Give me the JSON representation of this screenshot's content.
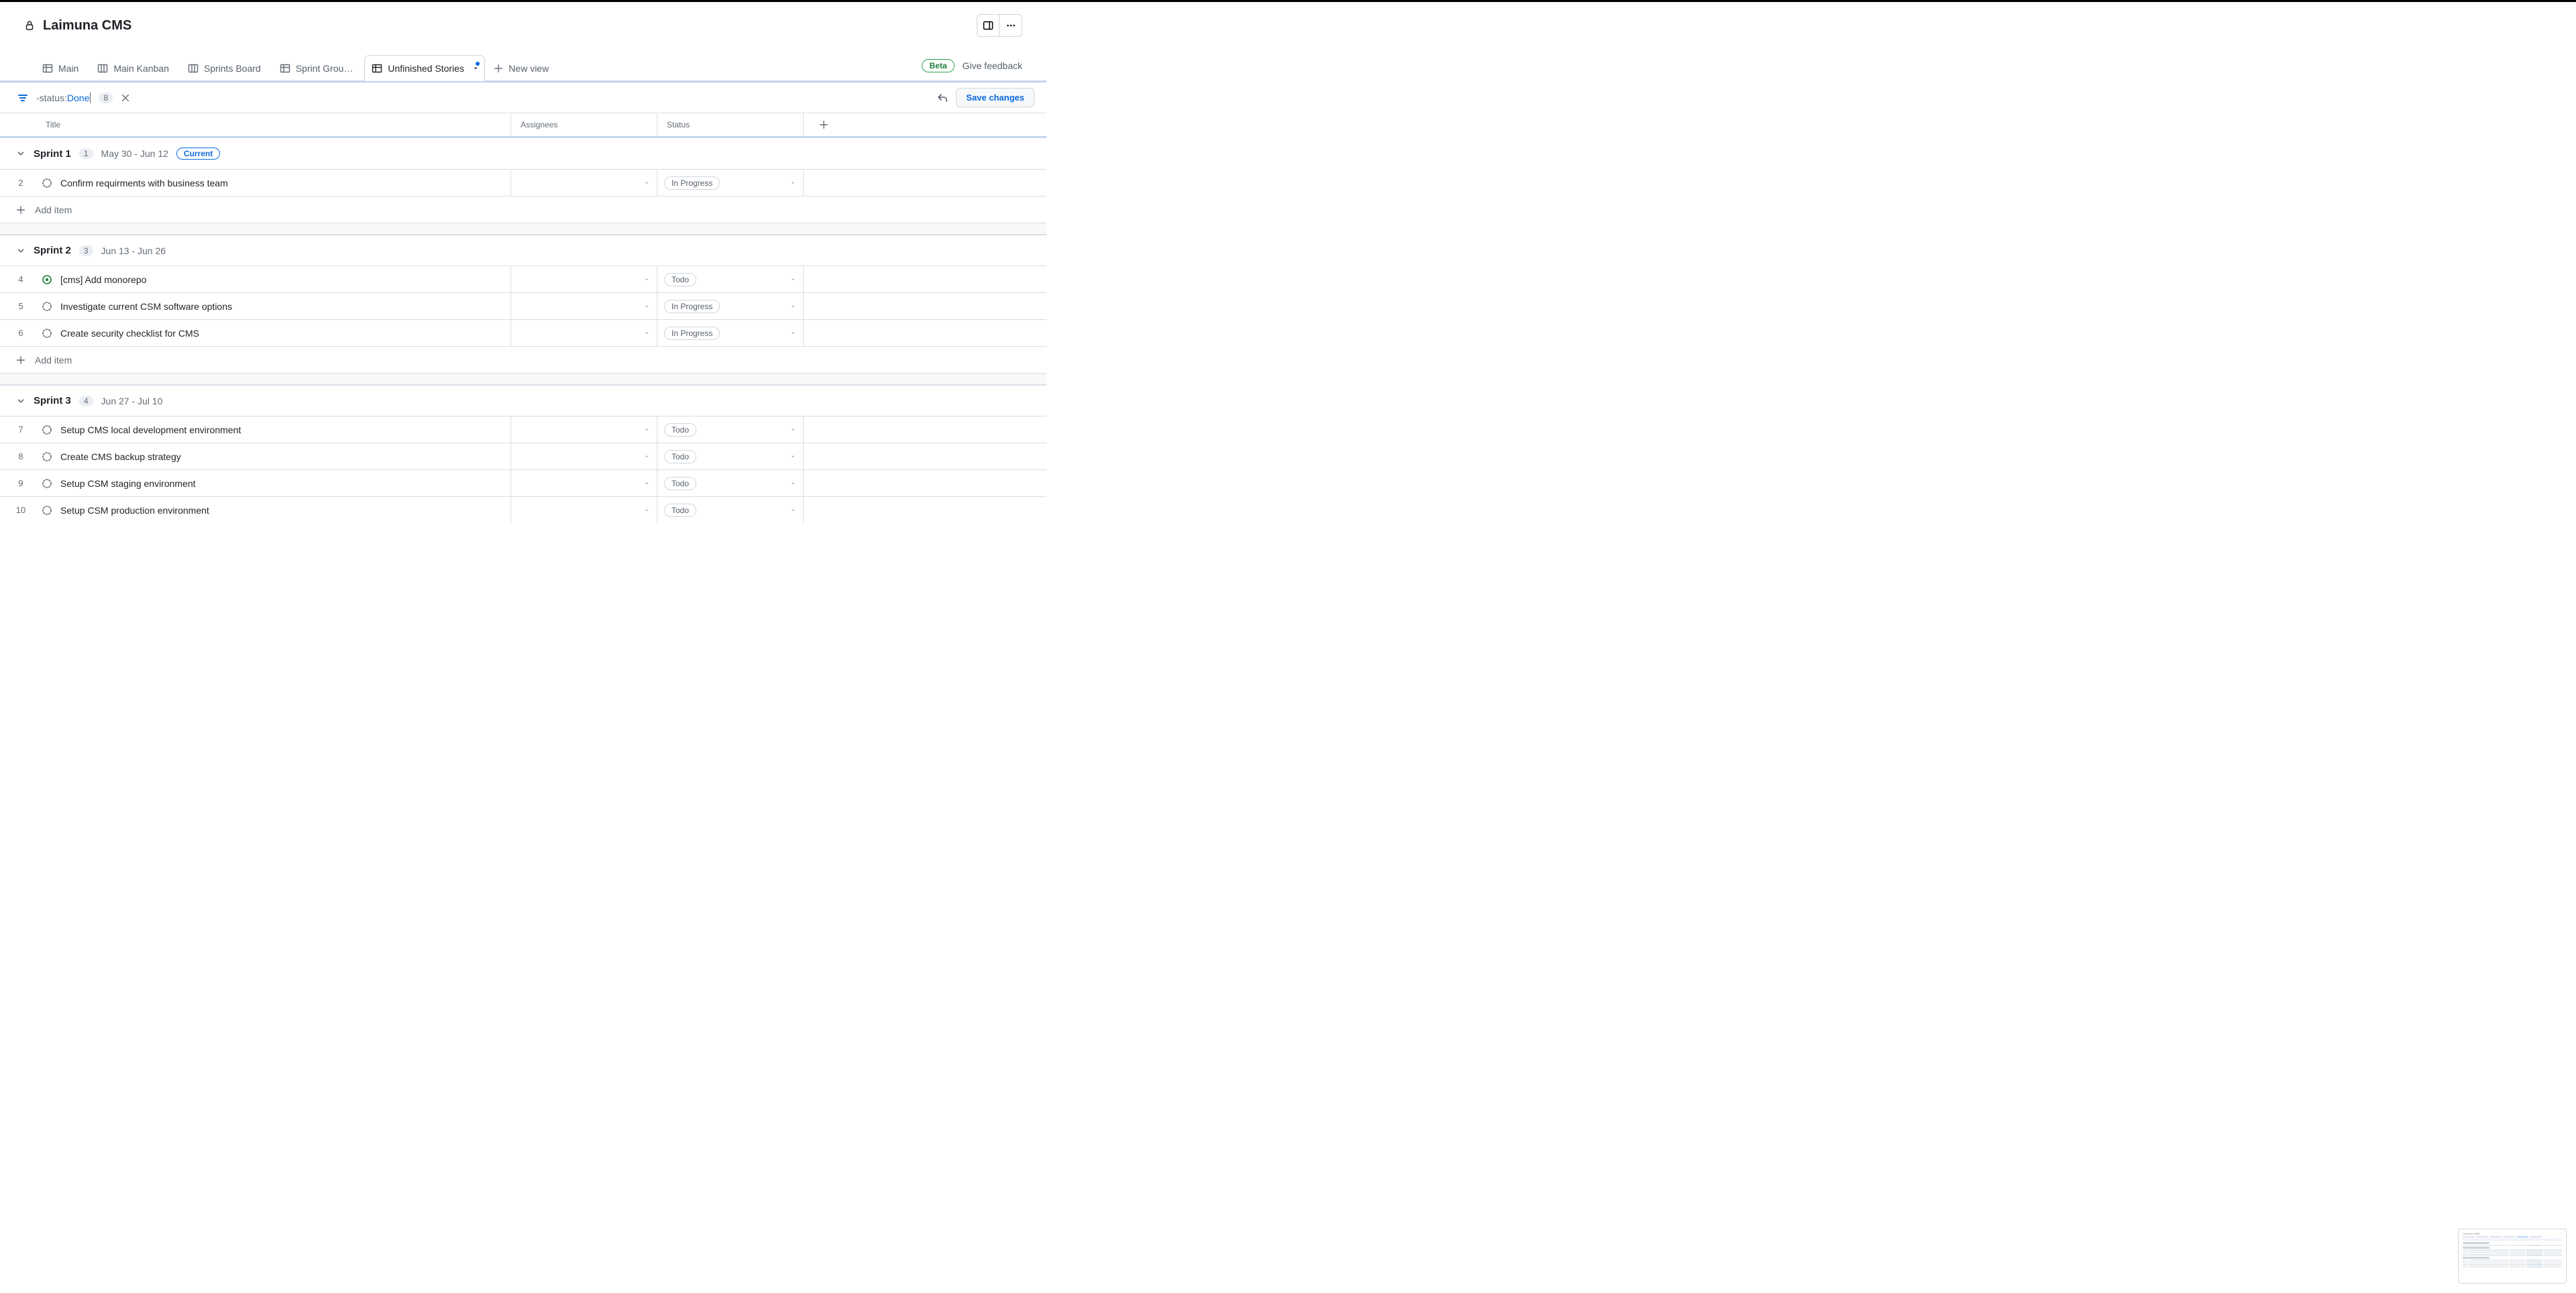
{
  "project": {
    "title": "Laimuna CMS"
  },
  "header_actions": {
    "panel_toggle": "Toggle insights panel",
    "more_menu": "More options"
  },
  "tabs": {
    "items": [
      {
        "label": "Main",
        "icon": "table"
      },
      {
        "label": "Main Kanban",
        "icon": "board"
      },
      {
        "label": "Sprints Board",
        "icon": "board"
      },
      {
        "label": "Sprint Grou…",
        "icon": "table"
      },
      {
        "label": "Unfinished Stories",
        "icon": "table",
        "active": true,
        "has_indicator": true
      }
    ],
    "new_view_label": "New view",
    "beta_label": "Beta",
    "feedback_label": "Give feedback"
  },
  "filter": {
    "prefix": "-status:",
    "value": "Done",
    "count": "8",
    "save_label": "Save changes"
  },
  "columns": {
    "title": "Title",
    "assignees": "Assignees",
    "status": "Status"
  },
  "add_item_label": "Add item",
  "groups": [
    {
      "name": "Sprint 1",
      "count": "1",
      "dates": "May 30 - Jun 12",
      "current": true,
      "current_label": "Current",
      "items": [
        {
          "num": "2",
          "icon": "draft",
          "title": "Confirm requirments with business team",
          "status": "In Progress"
        }
      ],
      "show_add": true
    },
    {
      "name": "Sprint 2",
      "count": "3",
      "dates": "Jun 13 - Jun 26",
      "current": false,
      "items": [
        {
          "num": "4",
          "icon": "open",
          "title": "[cms] Add monorepo",
          "status": "Todo"
        },
        {
          "num": "5",
          "icon": "draft",
          "title": "Investigate current CSM software options",
          "status": "In Progress"
        },
        {
          "num": "6",
          "icon": "draft",
          "title": "Create security checklist for CMS",
          "status": "In Progress"
        }
      ],
      "show_add": true
    },
    {
      "name": "Sprint 3",
      "count": "4",
      "dates": "Jun 27 - Jul 10",
      "current": false,
      "items": [
        {
          "num": "7",
          "icon": "draft",
          "title": "Setup CMS local development environment",
          "status": "Todo"
        },
        {
          "num": "8",
          "icon": "draft",
          "title": "Create CMS backup strategy",
          "status": "Todo"
        },
        {
          "num": "9",
          "icon": "draft",
          "title": "Setup CSM staging environment",
          "status": "Todo"
        },
        {
          "num": "10",
          "icon": "draft",
          "title": "Setup CSM production environment",
          "status": "Todo"
        }
      ],
      "show_add": false
    }
  ]
}
